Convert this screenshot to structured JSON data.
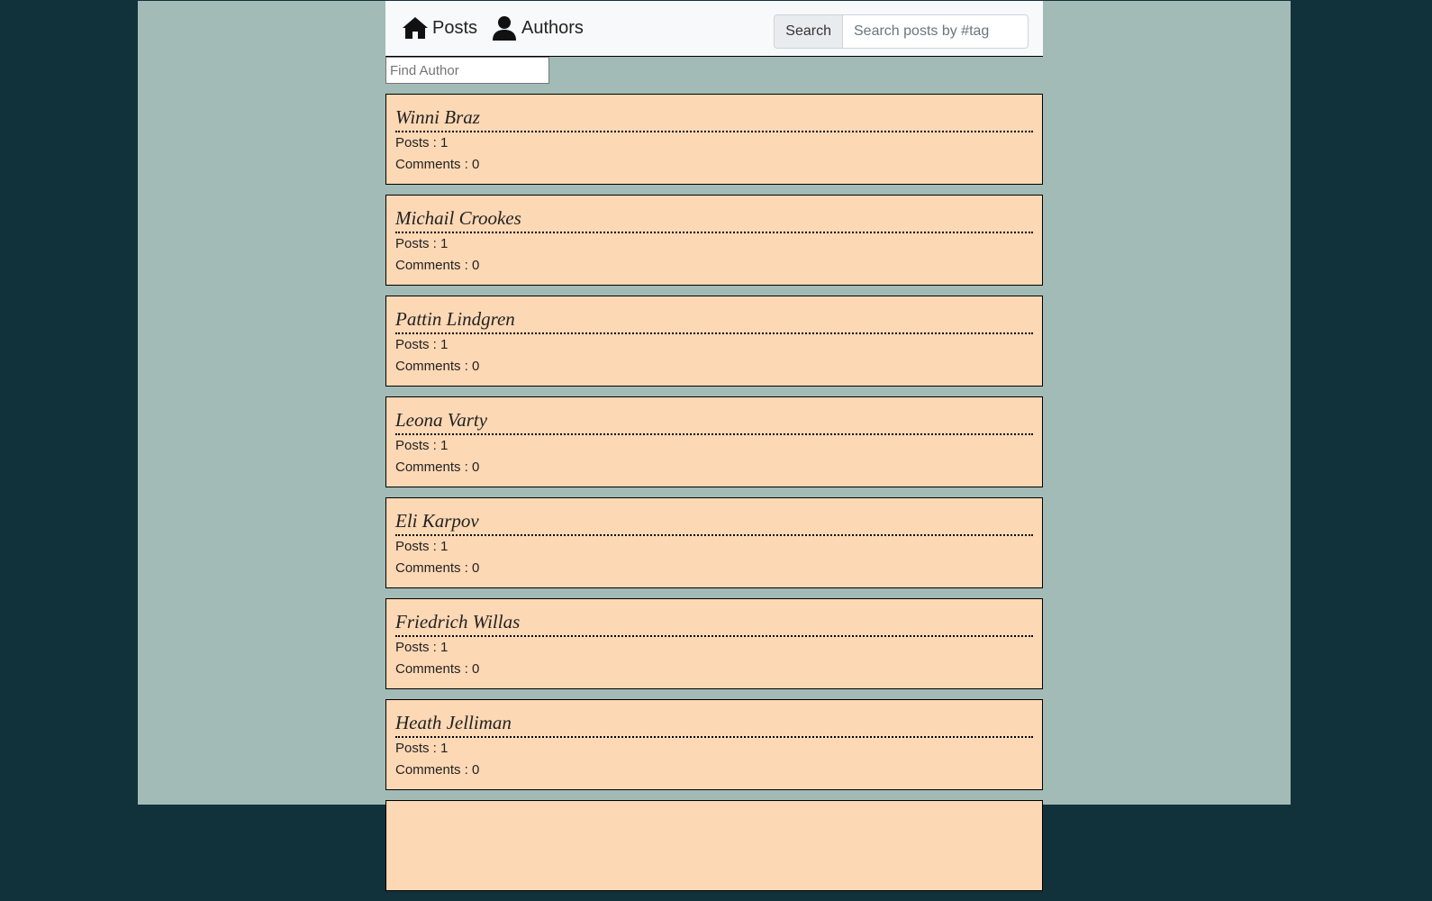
{
  "nav": {
    "posts_label": "Posts",
    "authors_label": "Authors",
    "posts_icon": "home-icon",
    "authors_icon": "user-icon"
  },
  "search": {
    "button_label": "Search",
    "placeholder": "Search posts by #tag",
    "value": ""
  },
  "filter": {
    "placeholder": "Find Author",
    "value": ""
  },
  "authors": [
    {
      "name": "Winni Braz",
      "posts": "Posts : 1",
      "comments": "Comments : 0"
    },
    {
      "name": "Michail Crookes",
      "posts": "Posts : 1",
      "comments": "Comments : 0"
    },
    {
      "name": "Pattin Lindgren",
      "posts": "Posts : 1",
      "comments": "Comments : 0"
    },
    {
      "name": "Leona Varty",
      "posts": "Posts : 1",
      "comments": "Comments : 0"
    },
    {
      "name": "Eli Karpov",
      "posts": "Posts : 1",
      "comments": "Comments : 0"
    },
    {
      "name": "Friedrich Willas",
      "posts": "Posts : 1",
      "comments": "Comments : 0"
    },
    {
      "name": "Heath Jelliman",
      "posts": "Posts : 1",
      "comments": "Comments : 0"
    }
  ],
  "colors": {
    "outer_bg": "#12323b",
    "page_bg": "#a3bbb6",
    "card_bg": "#fdd8b5",
    "navbar_bg": "#f8f9fa"
  }
}
